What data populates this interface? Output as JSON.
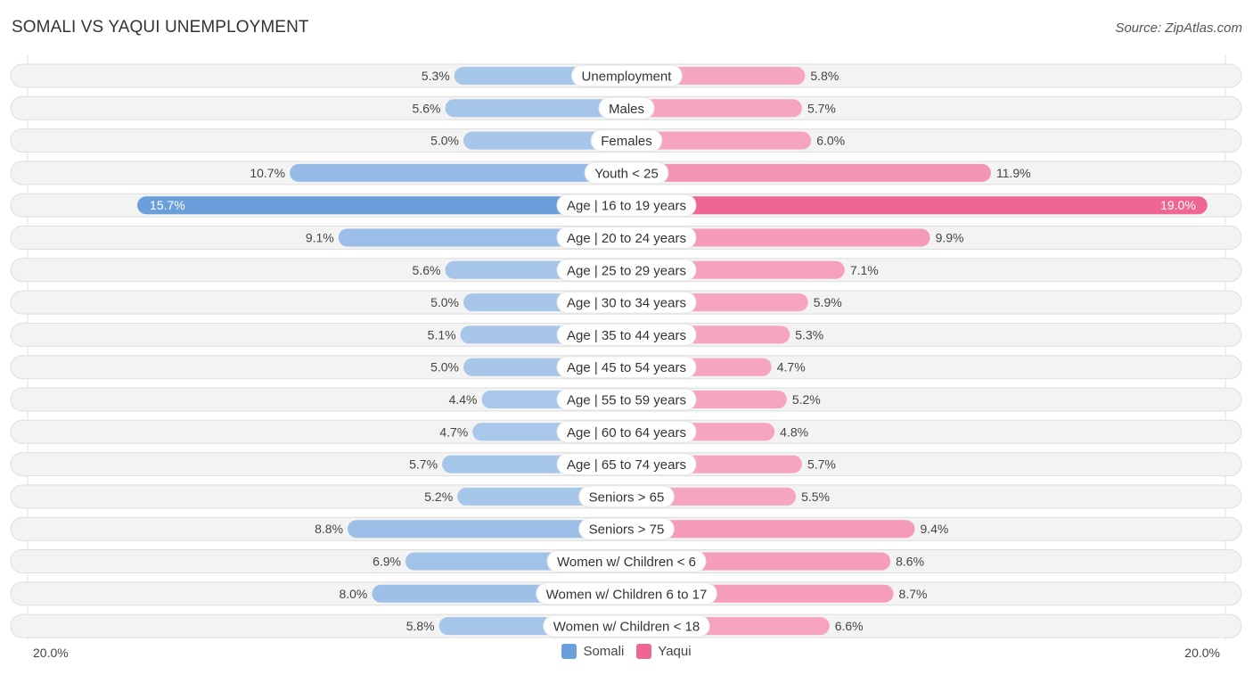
{
  "header": {
    "title": "SOMALI VS YAQUI UNEMPLOYMENT",
    "source": "Source: ZipAtlas.com"
  },
  "colors": {
    "somali": "#6a9fdc",
    "somali_light": "#a8c7ea",
    "yaqui": "#f06693",
    "yaqui_light": "#f6a5bf",
    "row_bg": "#f3f3f3",
    "row_border": "#dedede"
  },
  "chart_data": {
    "type": "bar",
    "orientation": "horizontal-diverging",
    "title": "SOMALI VS YAQUI UNEMPLOYMENT",
    "xlabel": "",
    "ylabel": "",
    "xlim": [
      -20.0,
      20.0
    ],
    "axis_labels": {
      "left": "20.0%",
      "right": "20.0%"
    },
    "legend_position": "bottom-center",
    "categories": [
      "Unemployment",
      "Males",
      "Females",
      "Youth < 25",
      "Age | 16 to 19 years",
      "Age | 20 to 24 years",
      "Age | 25 to 29 years",
      "Age | 30 to 34 years",
      "Age | 35 to 44 years",
      "Age | 45 to 54 years",
      "Age | 55 to 59 years",
      "Age | 60 to 64 years",
      "Age | 65 to 74 years",
      "Seniors > 65",
      "Seniors > 75",
      "Women w/ Children < 6",
      "Women w/ Children 6 to 17",
      "Women w/ Children < 18"
    ],
    "series": [
      {
        "name": "Somali",
        "side": "left",
        "values": [
          5.3,
          5.6,
          5.0,
          10.7,
          15.7,
          9.1,
          5.6,
          5.0,
          5.1,
          5.0,
          4.4,
          4.7,
          5.7,
          5.2,
          8.8,
          6.9,
          8.0,
          5.8
        ],
        "labels": [
          "5.3%",
          "5.6%",
          "5.0%",
          "10.7%",
          "15.7%",
          "9.1%",
          "5.6%",
          "5.0%",
          "5.1%",
          "5.0%",
          "4.4%",
          "4.7%",
          "5.7%",
          "5.2%",
          "8.8%",
          "6.9%",
          "8.0%",
          "5.8%"
        ]
      },
      {
        "name": "Yaqui",
        "side": "right",
        "values": [
          5.8,
          5.7,
          6.0,
          11.9,
          19.0,
          9.9,
          7.1,
          5.9,
          5.3,
          4.7,
          5.2,
          4.8,
          5.7,
          5.5,
          9.4,
          8.6,
          8.7,
          6.6
        ],
        "labels": [
          "5.8%",
          "5.7%",
          "6.0%",
          "11.9%",
          "19.0%",
          "9.9%",
          "7.1%",
          "5.9%",
          "5.3%",
          "4.7%",
          "5.2%",
          "4.8%",
          "5.7%",
          "5.5%",
          "9.4%",
          "8.6%",
          "8.7%",
          "6.6%"
        ]
      }
    ]
  },
  "legend": {
    "items": [
      {
        "label": "Somali"
      },
      {
        "label": "Yaqui"
      }
    ]
  }
}
